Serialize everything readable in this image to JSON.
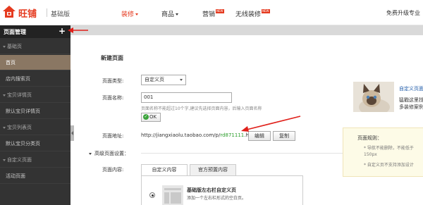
{
  "header": {
    "logo_text": "旺铺",
    "edition": "基础版",
    "nav": [
      {
        "label": "装修",
        "has_caret": true,
        "active": true
      },
      {
        "label": "商品",
        "has_caret": true,
        "active": false
      },
      {
        "label": "营销",
        "badge": "NEW",
        "active": false
      },
      {
        "label": "无线装修",
        "badge": "NEW",
        "active": false
      }
    ],
    "right_text": "免费升级专业"
  },
  "sidebar": {
    "title": "页面管理",
    "add_label": "+",
    "items": [
      {
        "label": "基础页",
        "type": "group"
      },
      {
        "label": "首页",
        "type": "item",
        "active": true
      },
      {
        "label": "店内搜索页",
        "type": "item"
      },
      {
        "label": "宝贝详情页",
        "type": "group"
      },
      {
        "label": "默认宝贝详情页",
        "type": "item"
      },
      {
        "label": "宝贝列表页",
        "type": "group"
      },
      {
        "label": "默认宝贝分类页",
        "type": "item"
      },
      {
        "label": "自定义页面",
        "type": "group"
      },
      {
        "label": "活动页面",
        "type": "item"
      }
    ]
  },
  "form": {
    "title": "新建页面",
    "page_type_label": "页面类型:",
    "page_type_value": "自定义页",
    "page_name_label": "页面名称:",
    "page_name_value": "001",
    "page_name_hint": "页面名称不能超过10个字,建议先选择页面内容，后输入页面名称",
    "ok_label": "OK",
    "address_label": "页面地址:",
    "url_prefix": "http://jiangxiaolu.taobao.com/p/",
    "url_id": "rd871111",
    "url_suffix": ".htm",
    "edit_label": "编辑",
    "copy_label": "复制",
    "advanced_label": "高级页面设置：",
    "content_label": "页面内容:",
    "tabs": [
      {
        "label": "自定义内容",
        "active": true
      },
      {
        "label": "官方预置内容",
        "active": false
      }
    ],
    "layout_option_title": "基础版左右栏自定义页",
    "layout_option_desc": "添加一个左右栏形式的空白页。"
  },
  "promo": {
    "link_text": "自定义页面",
    "lines": [
      "猛戳这里找",
      "多装修案例"
    ]
  },
  "notes": {
    "title": "页面规则：",
    "lines": [
      "* 导航不能删除，不能低于",
      "150px",
      "* 自定义页不支持添加设计"
    ]
  },
  "colors": {
    "brand_red": "#e53a1f",
    "sidebar_bg": "#333333",
    "sidebar_active": "#8a7763",
    "link_blue": "#1d5aa8",
    "url_green": "#2a9d2a"
  }
}
